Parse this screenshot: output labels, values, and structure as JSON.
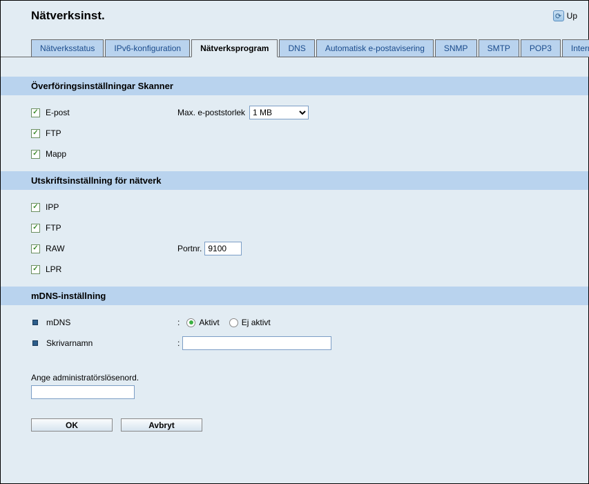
{
  "header": {
    "title": "Nätverksinst.",
    "refresh_label": "Up"
  },
  "tabs": [
    {
      "label": "Nätverksstatus",
      "active": false
    },
    {
      "label": "IPv6-konfiguration",
      "active": false
    },
    {
      "label": "Nätverksprogram",
      "active": true
    },
    {
      "label": "DNS",
      "active": false
    },
    {
      "label": "Automatisk e-postavisering",
      "active": false
    },
    {
      "label": "SNMP",
      "active": false
    },
    {
      "label": "SMTP",
      "active": false
    },
    {
      "label": "POP3",
      "active": false
    },
    {
      "label": "Intern",
      "active": false
    }
  ],
  "section_scanner": {
    "title": "Överföringsinställningar Skanner",
    "epost_label": "E-post",
    "ftp_label": "FTP",
    "mapp_label": "Mapp",
    "max_size_label": "Max. e-poststorlek",
    "max_size_value": "1 MB"
  },
  "section_print": {
    "title": "Utskriftsinställning för nätverk",
    "ipp_label": "IPP",
    "ftp_label": "FTP",
    "raw_label": "RAW",
    "lpr_label": "LPR",
    "port_label": "Portnr.",
    "port_value": "9100"
  },
  "section_mdns": {
    "title": "mDNS-inställning",
    "mdns_label": "mDNS",
    "printer_name_label": "Skrivarnamn",
    "radio_active": "Aktivt",
    "radio_inactive": "Ej aktivt",
    "printer_name_value": ""
  },
  "password": {
    "label": "Ange administratörslösenord.",
    "value": ""
  },
  "buttons": {
    "ok": "OK",
    "cancel": "Avbryt"
  }
}
